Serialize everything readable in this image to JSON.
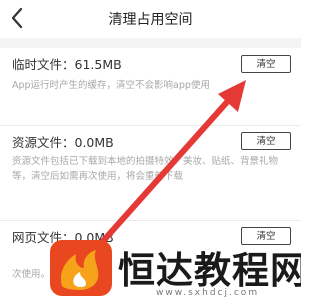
{
  "header": {
    "title": "清理占用空间"
  },
  "items": [
    {
      "title": "临时文件：61.5MB",
      "description": "App运行时产生的缓存，清空不会影响app使用",
      "button_label": "清空"
    },
    {
      "title": "资源文件：0.0MB",
      "description": "资源文件包括已下载到本地的拍摄特效、美妆、贴纸、背景礼物等，清空后如需再次使用，将会重新下载",
      "button_label": "清空"
    },
    {
      "title": "网页文件：0.0MB",
      "description": "次使用。",
      "button_label": "清空"
    }
  ],
  "watermark": {
    "brand": "恒达教程网",
    "url": "www.sxhdcj.com"
  },
  "colors": {
    "arrow": "#e53935",
    "logo_red": "#e8471f",
    "logo_orange": "#f7a21b",
    "divider": "#ececec",
    "desc_text": "#a8a8a8"
  },
  "icons": {
    "back": "chevron-left-icon",
    "logo": "flame-logo-icon"
  }
}
